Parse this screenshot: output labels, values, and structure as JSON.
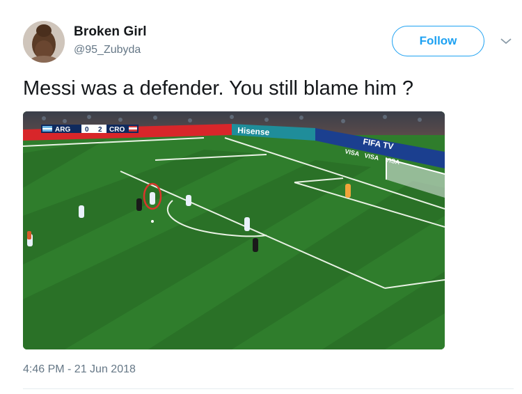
{
  "user": {
    "display_name": "Broken Girl",
    "handle": "@95_Zubyda"
  },
  "actions": {
    "follow_label": "Follow"
  },
  "tweet": {
    "text": "Messi was a defender. You still blame him ?",
    "timestamp": "4:46 PM - 21 Jun 2018"
  },
  "media": {
    "scoreboard": {
      "home_team": "ARG",
      "home_score": "0",
      "away_score": "2",
      "away_team": "CRO"
    },
    "ad_boards": [
      "Hisense",
      "FIFA TV",
      "VISA",
      "VISA",
      "VISA"
    ]
  },
  "colors": {
    "accent": "#1da1f2",
    "text_primary": "#14171a",
    "text_secondary": "#657786",
    "pitch_green": "#2f7a2a",
    "highlight_circle": "#d9362b"
  },
  "icons": {
    "more_options": "chevron-down-icon"
  }
}
